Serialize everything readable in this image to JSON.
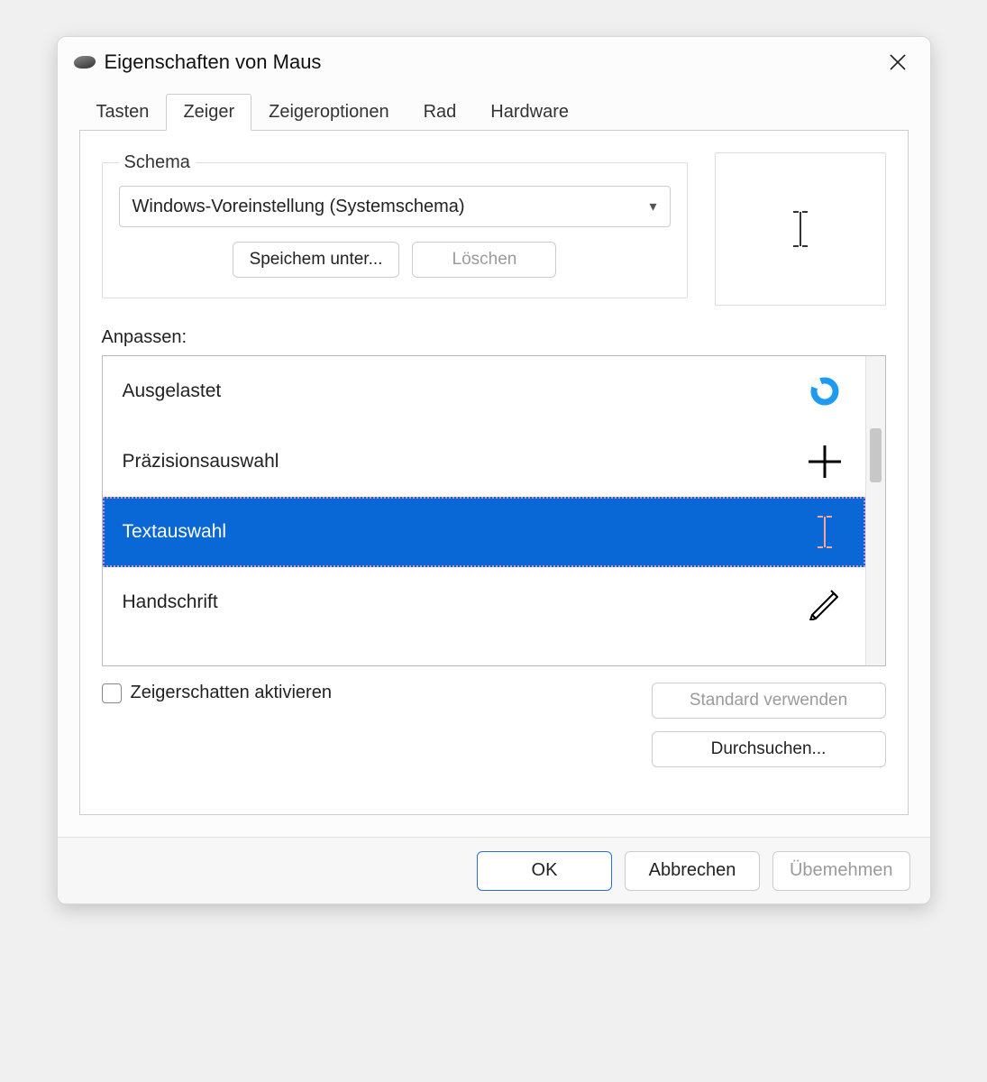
{
  "title": "Eigenschaften von Maus",
  "tabs": [
    "Tasten",
    "Zeiger",
    "Zeigeroptionen",
    "Rad",
    "Hardware"
  ],
  "active_tab_index": 1,
  "schema": {
    "legend": "Schema",
    "selected": "Windows-Voreinstellung (Systemschema)",
    "save_as": "Speichem unter...",
    "delete": "Löschen"
  },
  "customize_label": "Anpassen:",
  "list": [
    {
      "label": "Ausgelastet",
      "icon": "busy-ring-icon",
      "selected": false
    },
    {
      "label": "Präzisionsauswahl",
      "icon": "crosshair-icon",
      "selected": false
    },
    {
      "label": "Textauswahl",
      "icon": "ibeam-icon",
      "selected": true
    },
    {
      "label": "Handschrift",
      "icon": "pen-icon",
      "selected": false
    }
  ],
  "shadow_checkbox": "Zeigerschatten aktivieren",
  "buttons": {
    "use_default": "Standard verwenden",
    "browse": "Durchsuchen...",
    "ok": "OK",
    "cancel": "Abbrechen",
    "apply": "Übemehmen"
  }
}
